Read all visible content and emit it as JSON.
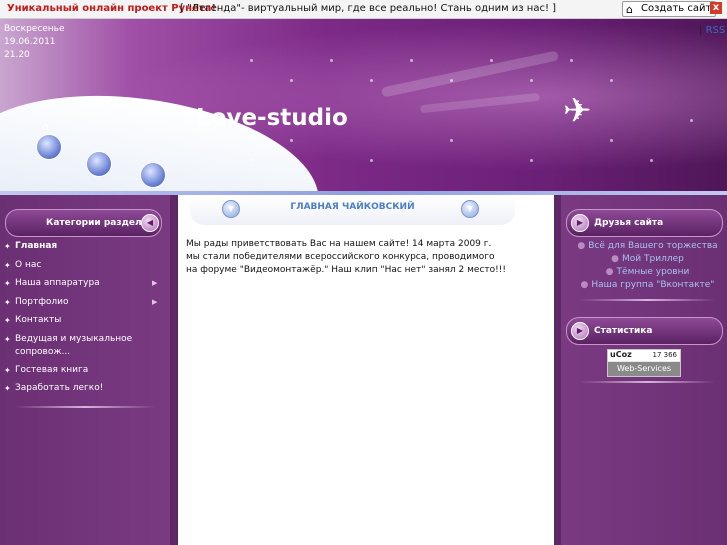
{
  "topbar": {
    "promo": "Уникальный онлайн проект Рунета!",
    "legend": "[ \"Легенда\"- виртуальный мир, где все реально! Стань одним из нас! ]",
    "create_button": "Создать сайт",
    "close": "x"
  },
  "header": {
    "day": "Воскресенье",
    "date": "19.06.2011",
    "time": "21.20",
    "rss_sep": "|",
    "rss": "RSS",
    "site_title": "Love-studio"
  },
  "left": {
    "heading": "Категории раздела",
    "menu": [
      {
        "label": "Главная",
        "active": true,
        "submenu": false
      },
      {
        "label": "О нас",
        "submenu": false
      },
      {
        "label": "Наша аппаратура",
        "submenu": true
      },
      {
        "label": "Портфолио",
        "submenu": true
      },
      {
        "label": "Контакты",
        "submenu": false
      },
      {
        "label": "Ведущая и музыкальное сопровож...",
        "submenu": false
      },
      {
        "label": "Гостевая книга",
        "submenu": false
      },
      {
        "label": "Заработать легко!",
        "submenu": false
      }
    ]
  },
  "main": {
    "heading": "ГЛАВНАЯ ЧАЙКОВСКИЙ",
    "text": "Мы рады приветствовать Вас на нашем сайте! 14 марта 2009 г. мы стали победителями всероссийского конкурса, проводимого на форуме \"Видеомонтажёр.\" Наш клип \"Нас нет\" занял 2 место!!!"
  },
  "right": {
    "friends_heading": "Друзья сайта",
    "friends": [
      "Всё для Вашего торжества",
      "Мой Триллер",
      "Тёмные уровни",
      "Наша группа \"Вконтакте\""
    ],
    "stats_heading": "Статистика",
    "counter_brand": "uCoz",
    "counter_value": "17 366",
    "counter_caption": "Web-Services"
  }
}
